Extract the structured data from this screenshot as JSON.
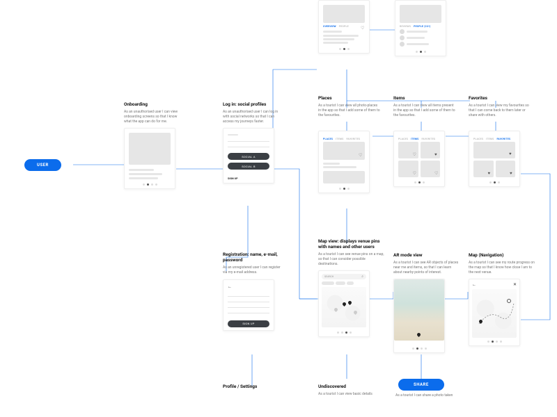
{
  "entry_pill": "USER",
  "share_pill": "SHARE",
  "onboarding": {
    "title": "Onboarding",
    "desc": "As an unauthorised user I can view onboarding screens so that I know what the app can do for me."
  },
  "login": {
    "title": "Log in: social profiles",
    "desc": "As an unauthorised user I can log in with social networks so that I can access my journeys faster.",
    "social_a": "SOCIAL A",
    "social_b": "SOCIAL B",
    "signup": "SIGN UP"
  },
  "places": {
    "title": "Places",
    "desc": "As a tourist I can view all photo-places in the app so that I add some of them to the favourites.",
    "tab_overview": "OVERVIEW",
    "tab_people": "PEOPLE",
    "tab_people_count": "PEOPLE (231)",
    "tab_reviews": "REVIEWS"
  },
  "items": {
    "title": "Items",
    "desc": "As a tourist I can view all items present in the app so that I add some of them to the favourites."
  },
  "favorites": {
    "title": "Favorites",
    "desc": "As a tourist I can view my favourites so that I can come back to them later or share with others."
  },
  "tabs_row": {
    "places": "PLACES",
    "items": "ITEMS",
    "favorites": "FAVORITES"
  },
  "registration": {
    "title": "Registration: name, e-mail, password",
    "desc": "As an unregistered user I can register via my e-mail address.",
    "signup": "SIGN UP"
  },
  "mapview": {
    "title": "Map view: displays venue pins with names and other users",
    "desc": "As a tourist I can see venue pins on a map, so that I can consider possible destinations.",
    "search": "SEARCH"
  },
  "armode": {
    "title": "AR mode view",
    "desc": "As a tourist I can see AR objects of places near me and items, so that I can learn about nearby points of interest."
  },
  "mapnav": {
    "title": "Map (Navigation)",
    "desc": "As a tourist I can see my route progress on the map so that I know how close I am to the next venue."
  },
  "profile": {
    "title": "Profile / Settings"
  },
  "undiscovered": {
    "title": "Undiscovered",
    "desc": "As a tourist I can view basic details"
  },
  "share_desc": "As a tourist I can share a photo taken"
}
